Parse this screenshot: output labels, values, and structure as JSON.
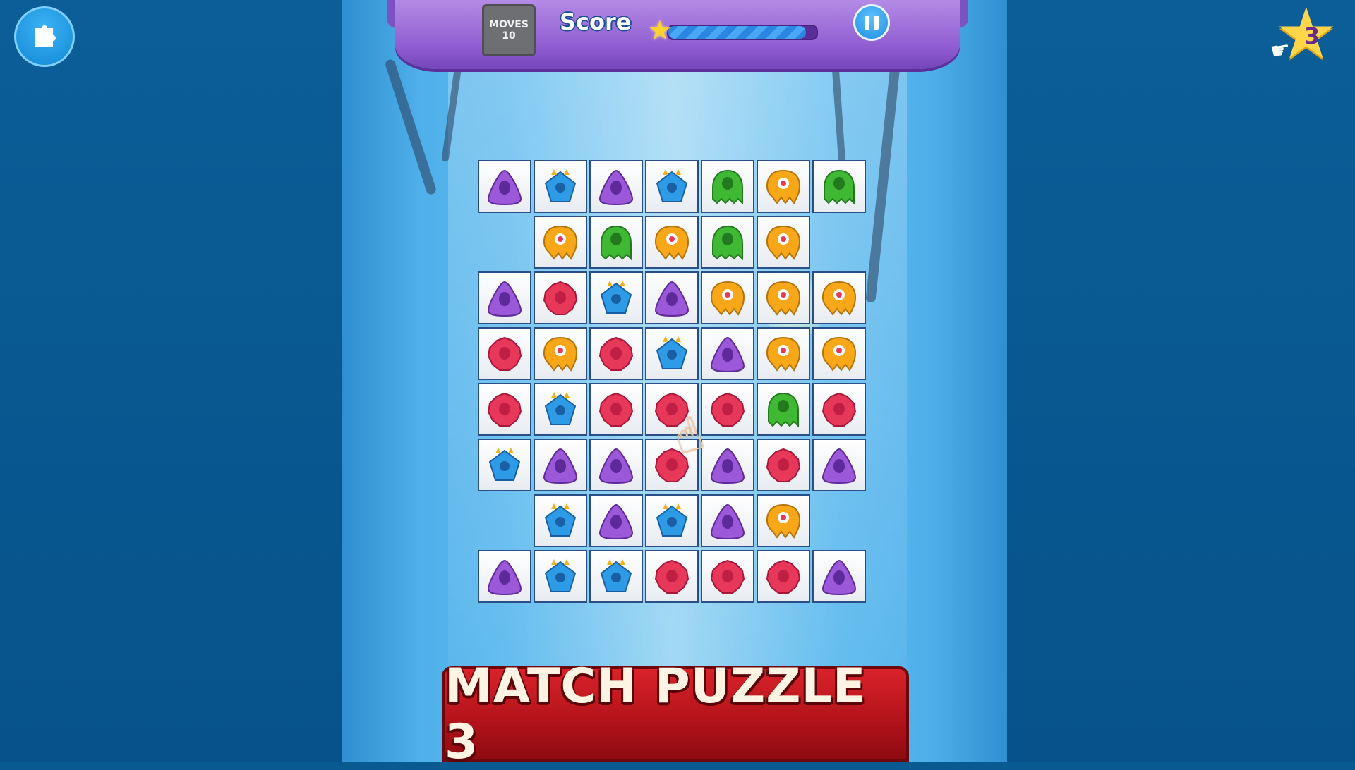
{
  "header": {
    "moves_label": "MOVES",
    "moves_value": "10",
    "score_label": "Score",
    "score_progress": 0.93,
    "pause_icon": "pause-icon"
  },
  "top_left_button": {
    "icon": "puzzle-pieces-icon"
  },
  "star_badge": {
    "count": "3",
    "icon": "star-icon"
  },
  "title": "MATCH PUZZLE 3",
  "colors": {
    "purple": "#9b59d9",
    "blue": "#2d9be6",
    "green": "#3fb834",
    "orange": "#f7a718",
    "red": "#e8385a",
    "banner": "#9466d6",
    "title_plate": "#c8161e"
  },
  "board": {
    "rows": [
      [
        "purple",
        "blue",
        "purple",
        "blue",
        "green",
        "orange",
        "green"
      ],
      [
        "",
        "orange",
        "green",
        "orange",
        "green",
        "orange",
        ""
      ],
      [
        "purple",
        "red",
        "blue",
        "purple",
        "orange",
        "orange",
        "orange"
      ],
      [
        "red",
        "orange",
        "red",
        "blue",
        "purple",
        "orange",
        "orange"
      ],
      [
        "red",
        "blue",
        "red",
        "red",
        "red",
        "green",
        "red"
      ],
      [
        "blue",
        "purple",
        "purple",
        "red",
        "purple",
        "red",
        "purple"
      ],
      [
        "",
        "blue",
        "purple",
        "blue",
        "purple",
        "orange",
        ""
      ],
      [
        "purple",
        "blue",
        "blue",
        "red",
        "red",
        "red",
        "purple"
      ]
    ]
  },
  "hint": {
    "icon": "pointing-hand-icon"
  }
}
